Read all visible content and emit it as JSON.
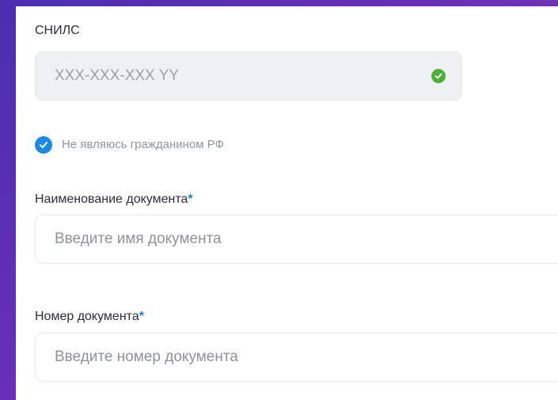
{
  "snils": {
    "label": "СНИЛС",
    "value": "XXX-XXX-XXX YY"
  },
  "citizenship_checkbox": {
    "checked": true,
    "label": "Не являюсь гражданином РФ"
  },
  "document_name": {
    "label": "Наименование документа",
    "required_mark": "*",
    "placeholder": "Введите имя документа"
  },
  "document_number": {
    "label": "Номер документа",
    "required_mark": "*",
    "placeholder": "Введите номер документа"
  },
  "colors": {
    "background_gradient_start": "#4a2fb0",
    "background_gradient_end": "#8a3ab8",
    "success": "#4caf3a",
    "checkbox": "#1e88e5",
    "required": "#1f7fbf"
  },
  "icons": {
    "validation": "check-circle-icon",
    "checkbox": "checkmark-icon"
  }
}
